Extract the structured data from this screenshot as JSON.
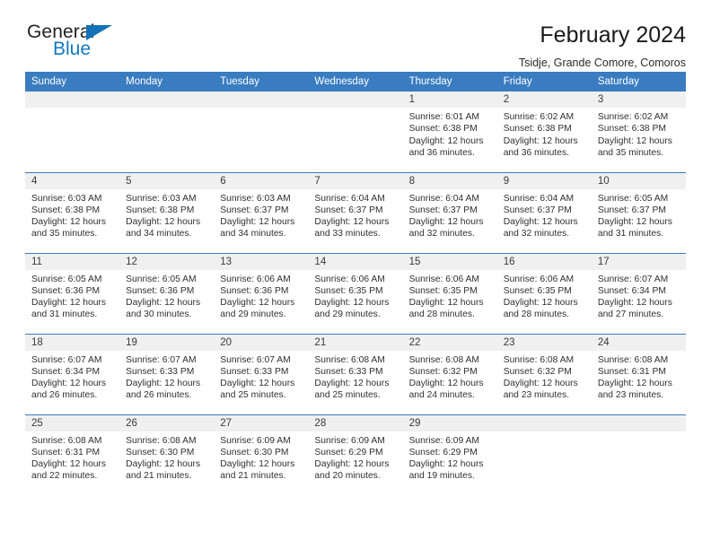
{
  "brand": {
    "name_part1": "General",
    "name_part2": "Blue",
    "triangle_icon": "blue-triangle-logo-mark",
    "color_dark": "#231f20",
    "color_blue": "#1178be"
  },
  "header": {
    "title": "February 2024",
    "subtitle": "Tsidje, Grande Comore, Comoros"
  },
  "theme": {
    "header_bg": "#3a7cc0",
    "daynum_bg": "#f0f0f0",
    "grid_line": "#3a7cc0",
    "text": "#303030"
  },
  "weekdays": [
    "Sunday",
    "Monday",
    "Tuesday",
    "Wednesday",
    "Thursday",
    "Friday",
    "Saturday"
  ],
  "weeks": [
    [
      {
        "day": "",
        "sunrise": "",
        "sunset": "",
        "daylight_line1": "",
        "daylight_line2": ""
      },
      {
        "day": "",
        "sunrise": "",
        "sunset": "",
        "daylight_line1": "",
        "daylight_line2": ""
      },
      {
        "day": "",
        "sunrise": "",
        "sunset": "",
        "daylight_line1": "",
        "daylight_line2": ""
      },
      {
        "day": "",
        "sunrise": "",
        "sunset": "",
        "daylight_line1": "",
        "daylight_line2": ""
      },
      {
        "day": "1",
        "sunrise": "Sunrise: 6:01 AM",
        "sunset": "Sunset: 6:38 PM",
        "daylight_line1": "Daylight: 12 hours",
        "daylight_line2": "and 36 minutes."
      },
      {
        "day": "2",
        "sunrise": "Sunrise: 6:02 AM",
        "sunset": "Sunset: 6:38 PM",
        "daylight_line1": "Daylight: 12 hours",
        "daylight_line2": "and 36 minutes."
      },
      {
        "day": "3",
        "sunrise": "Sunrise: 6:02 AM",
        "sunset": "Sunset: 6:38 PM",
        "daylight_line1": "Daylight: 12 hours",
        "daylight_line2": "and 35 minutes."
      }
    ],
    [
      {
        "day": "4",
        "sunrise": "Sunrise: 6:03 AM",
        "sunset": "Sunset: 6:38 PM",
        "daylight_line1": "Daylight: 12 hours",
        "daylight_line2": "and 35 minutes."
      },
      {
        "day": "5",
        "sunrise": "Sunrise: 6:03 AM",
        "sunset": "Sunset: 6:38 PM",
        "daylight_line1": "Daylight: 12 hours",
        "daylight_line2": "and 34 minutes."
      },
      {
        "day": "6",
        "sunrise": "Sunrise: 6:03 AM",
        "sunset": "Sunset: 6:37 PM",
        "daylight_line1": "Daylight: 12 hours",
        "daylight_line2": "and 34 minutes."
      },
      {
        "day": "7",
        "sunrise": "Sunrise: 6:04 AM",
        "sunset": "Sunset: 6:37 PM",
        "daylight_line1": "Daylight: 12 hours",
        "daylight_line2": "and 33 minutes."
      },
      {
        "day": "8",
        "sunrise": "Sunrise: 6:04 AM",
        "sunset": "Sunset: 6:37 PM",
        "daylight_line1": "Daylight: 12 hours",
        "daylight_line2": "and 32 minutes."
      },
      {
        "day": "9",
        "sunrise": "Sunrise: 6:04 AM",
        "sunset": "Sunset: 6:37 PM",
        "daylight_line1": "Daylight: 12 hours",
        "daylight_line2": "and 32 minutes."
      },
      {
        "day": "10",
        "sunrise": "Sunrise: 6:05 AM",
        "sunset": "Sunset: 6:37 PM",
        "daylight_line1": "Daylight: 12 hours",
        "daylight_line2": "and 31 minutes."
      }
    ],
    [
      {
        "day": "11",
        "sunrise": "Sunrise: 6:05 AM",
        "sunset": "Sunset: 6:36 PM",
        "daylight_line1": "Daylight: 12 hours",
        "daylight_line2": "and 31 minutes."
      },
      {
        "day": "12",
        "sunrise": "Sunrise: 6:05 AM",
        "sunset": "Sunset: 6:36 PM",
        "daylight_line1": "Daylight: 12 hours",
        "daylight_line2": "and 30 minutes."
      },
      {
        "day": "13",
        "sunrise": "Sunrise: 6:06 AM",
        "sunset": "Sunset: 6:36 PM",
        "daylight_line1": "Daylight: 12 hours",
        "daylight_line2": "and 29 minutes."
      },
      {
        "day": "14",
        "sunrise": "Sunrise: 6:06 AM",
        "sunset": "Sunset: 6:35 PM",
        "daylight_line1": "Daylight: 12 hours",
        "daylight_line2": "and 29 minutes."
      },
      {
        "day": "15",
        "sunrise": "Sunrise: 6:06 AM",
        "sunset": "Sunset: 6:35 PM",
        "daylight_line1": "Daylight: 12 hours",
        "daylight_line2": "and 28 minutes."
      },
      {
        "day": "16",
        "sunrise": "Sunrise: 6:06 AM",
        "sunset": "Sunset: 6:35 PM",
        "daylight_line1": "Daylight: 12 hours",
        "daylight_line2": "and 28 minutes."
      },
      {
        "day": "17",
        "sunrise": "Sunrise: 6:07 AM",
        "sunset": "Sunset: 6:34 PM",
        "daylight_line1": "Daylight: 12 hours",
        "daylight_line2": "and 27 minutes."
      }
    ],
    [
      {
        "day": "18",
        "sunrise": "Sunrise: 6:07 AM",
        "sunset": "Sunset: 6:34 PM",
        "daylight_line1": "Daylight: 12 hours",
        "daylight_line2": "and 26 minutes."
      },
      {
        "day": "19",
        "sunrise": "Sunrise: 6:07 AM",
        "sunset": "Sunset: 6:33 PM",
        "daylight_line1": "Daylight: 12 hours",
        "daylight_line2": "and 26 minutes."
      },
      {
        "day": "20",
        "sunrise": "Sunrise: 6:07 AM",
        "sunset": "Sunset: 6:33 PM",
        "daylight_line1": "Daylight: 12 hours",
        "daylight_line2": "and 25 minutes."
      },
      {
        "day": "21",
        "sunrise": "Sunrise: 6:08 AM",
        "sunset": "Sunset: 6:33 PM",
        "daylight_line1": "Daylight: 12 hours",
        "daylight_line2": "and 25 minutes."
      },
      {
        "day": "22",
        "sunrise": "Sunrise: 6:08 AM",
        "sunset": "Sunset: 6:32 PM",
        "daylight_line1": "Daylight: 12 hours",
        "daylight_line2": "and 24 minutes."
      },
      {
        "day": "23",
        "sunrise": "Sunrise: 6:08 AM",
        "sunset": "Sunset: 6:32 PM",
        "daylight_line1": "Daylight: 12 hours",
        "daylight_line2": "and 23 minutes."
      },
      {
        "day": "24",
        "sunrise": "Sunrise: 6:08 AM",
        "sunset": "Sunset: 6:31 PM",
        "daylight_line1": "Daylight: 12 hours",
        "daylight_line2": "and 23 minutes."
      }
    ],
    [
      {
        "day": "25",
        "sunrise": "Sunrise: 6:08 AM",
        "sunset": "Sunset: 6:31 PM",
        "daylight_line1": "Daylight: 12 hours",
        "daylight_line2": "and 22 minutes."
      },
      {
        "day": "26",
        "sunrise": "Sunrise: 6:08 AM",
        "sunset": "Sunset: 6:30 PM",
        "daylight_line1": "Daylight: 12 hours",
        "daylight_line2": "and 21 minutes."
      },
      {
        "day": "27",
        "sunrise": "Sunrise: 6:09 AM",
        "sunset": "Sunset: 6:30 PM",
        "daylight_line1": "Daylight: 12 hours",
        "daylight_line2": "and 21 minutes."
      },
      {
        "day": "28",
        "sunrise": "Sunrise: 6:09 AM",
        "sunset": "Sunset: 6:29 PM",
        "daylight_line1": "Daylight: 12 hours",
        "daylight_line2": "and 20 minutes."
      },
      {
        "day": "29",
        "sunrise": "Sunrise: 6:09 AM",
        "sunset": "Sunset: 6:29 PM",
        "daylight_line1": "Daylight: 12 hours",
        "daylight_line2": "and 19 minutes."
      },
      {
        "day": "",
        "sunrise": "",
        "sunset": "",
        "daylight_line1": "",
        "daylight_line2": ""
      },
      {
        "day": "",
        "sunrise": "",
        "sunset": "",
        "daylight_line1": "",
        "daylight_line2": ""
      }
    ]
  ]
}
